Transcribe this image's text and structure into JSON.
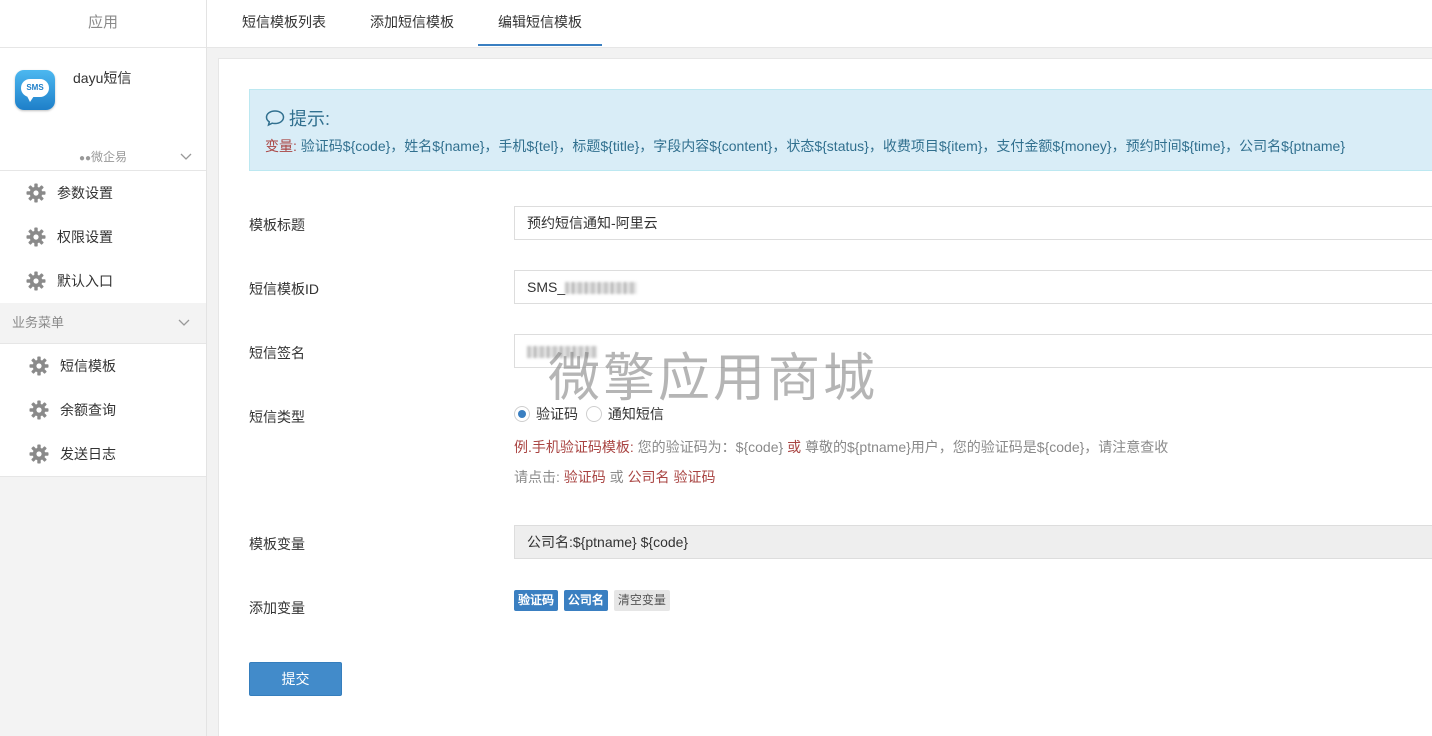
{
  "sidebar": {
    "header": "应用",
    "app": {
      "name": "dayu短信",
      "logo_text": "SMS",
      "source": "微企易"
    },
    "group1": [
      {
        "label": "参数设置"
      },
      {
        "label": "权限设置"
      },
      {
        "label": "默认入口"
      }
    ],
    "section_title": "业务菜单",
    "group2": [
      {
        "label": "短信模板"
      },
      {
        "label": "余额查询"
      },
      {
        "label": "发送日志"
      }
    ]
  },
  "tabs": [
    {
      "label": "短信模板列表"
    },
    {
      "label": "添加短信模板"
    },
    {
      "label": "编辑短信模板",
      "active": true
    }
  ],
  "tip": {
    "title": "提示:",
    "prefix": "变量:",
    "text": " 验证码${code}，姓名${name}，手机${tel}，标题${title}，字段内容${content}，状态${status}，收费项目${item}，支付金额${money}，预约时间${time}，公司名${ptname}"
  },
  "form": {
    "title_label": "模板标题",
    "title_value": "预约短信通知-阿里云",
    "template_id_label": "短信模板ID",
    "template_id_prefix": "SMS_",
    "signature_label": "短信签名",
    "type_label": "短信类型",
    "type_options": [
      "验证码",
      "通知短信"
    ],
    "type_selected": "验证码",
    "example_prefix": "例.手机验证码模板:",
    "example_part1": " 您的验证码为：${code} ",
    "example_or": "或",
    "example_part2": " 尊敬的${ptname}用户，您的验证码是${code}，请注意查收",
    "click_prefix": "请点击:",
    "click_link1": "验证码",
    "click_or": "或",
    "click_link2": "公司名",
    "click_link3": "验证码",
    "vars_label": "模板变量",
    "vars_value": "公司名:${ptname} ${code}",
    "add_vars_label": "添加变量",
    "add_buttons": [
      "验证码",
      "公司名"
    ],
    "clear_button": "清空变量",
    "submit": "提交"
  },
  "watermark": "微擎应用商城",
  "colors": {
    "accent": "#3a7fc1",
    "tip_bg": "#d9edf7",
    "tip_text": "#31708f",
    "danger": "#a94442"
  }
}
